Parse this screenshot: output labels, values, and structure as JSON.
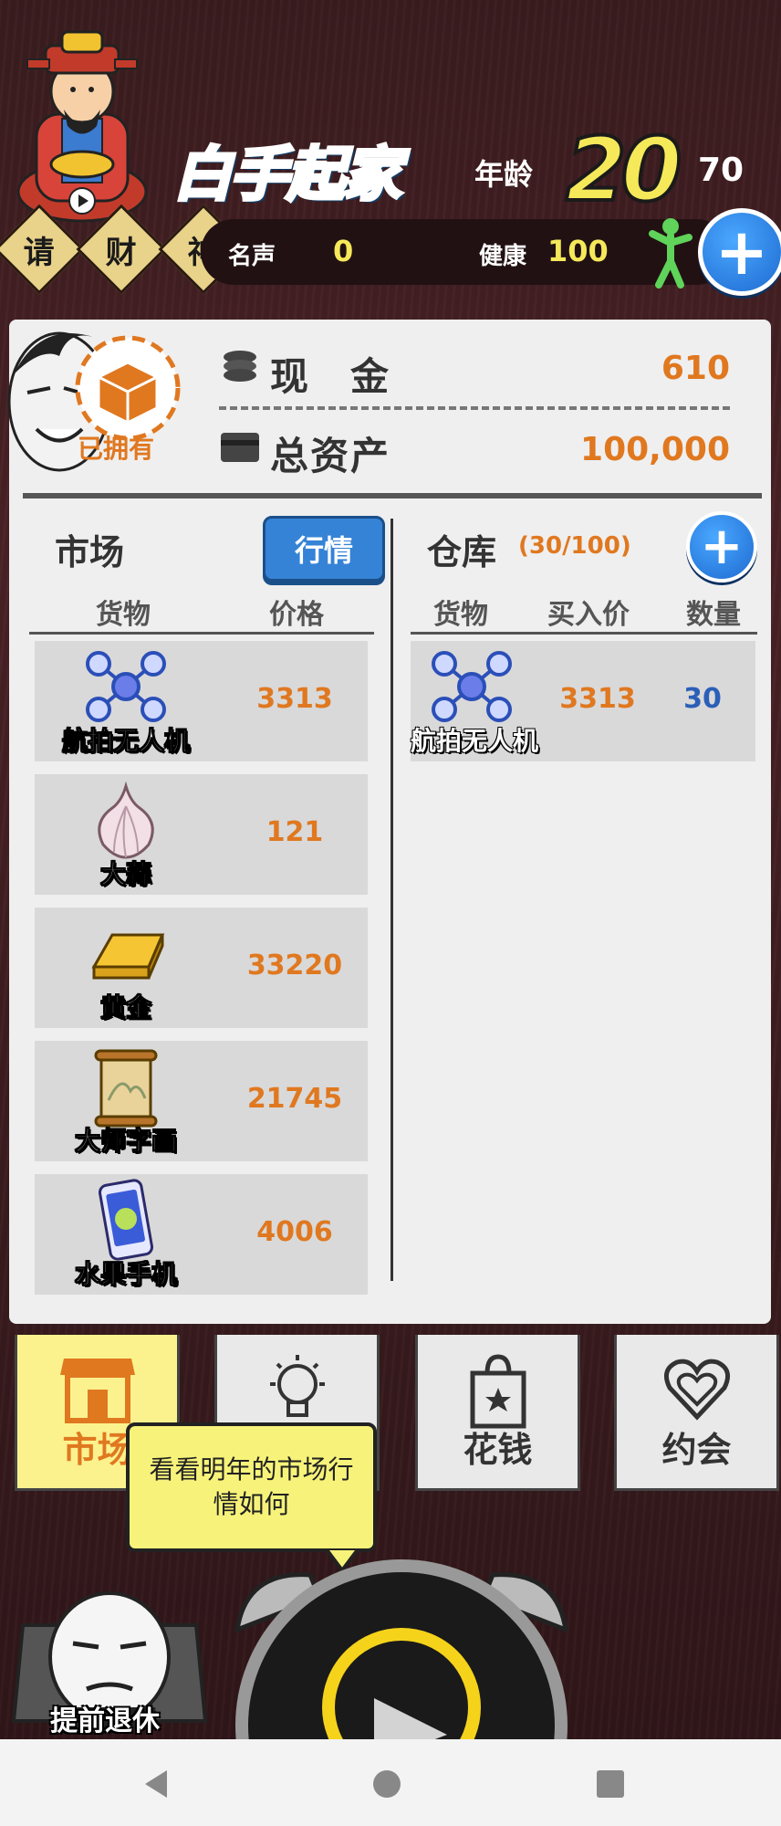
{
  "header": {
    "god_button_chars": [
      "请",
      "财",
      "神"
    ],
    "title": "白手起家",
    "age_label": "年龄",
    "age_value": "20",
    "age_max": "70",
    "fame_label": "名声",
    "fame_value": "0",
    "health_label": "健康",
    "health_value": "100"
  },
  "summary": {
    "owned_label": "已拥有",
    "cash_label": "现　金",
    "cash_value": "610",
    "assets_label": "总资产",
    "assets_value": "100,000"
  },
  "market": {
    "title": "市场",
    "trend_button": "行情",
    "col_goods": "货物",
    "col_price": "价格",
    "items": [
      {
        "name": "航拍无人机",
        "price": "3313",
        "icon": "drone-icon"
      },
      {
        "name": "大蒜",
        "price": "121",
        "icon": "garlic-icon"
      },
      {
        "name": "黄金",
        "price": "33220",
        "icon": "gold-bar-icon"
      },
      {
        "name": "大师字画",
        "price": "21745",
        "icon": "scroll-painting-icon"
      },
      {
        "name": "水果手机",
        "price": "4006",
        "icon": "phone-icon"
      }
    ]
  },
  "warehouse": {
    "title": "仓库",
    "capacity": "(30/100)",
    "col_goods": "货物",
    "col_buy_price": "买入价",
    "col_quantity": "数量",
    "items": [
      {
        "name": "航拍无人机",
        "buy_price": "3313",
        "quantity": "30",
        "icon": "drone-icon"
      }
    ]
  },
  "tabs": {
    "market": "市场",
    "spend": "花钱",
    "date": "约会"
  },
  "tooltip": "看看明年的市场行情如何",
  "retire_label": "提前退休",
  "colors": {
    "accent_orange": "#e07820",
    "accent_blue": "#3583d6",
    "yellow": "#f5e95a"
  }
}
